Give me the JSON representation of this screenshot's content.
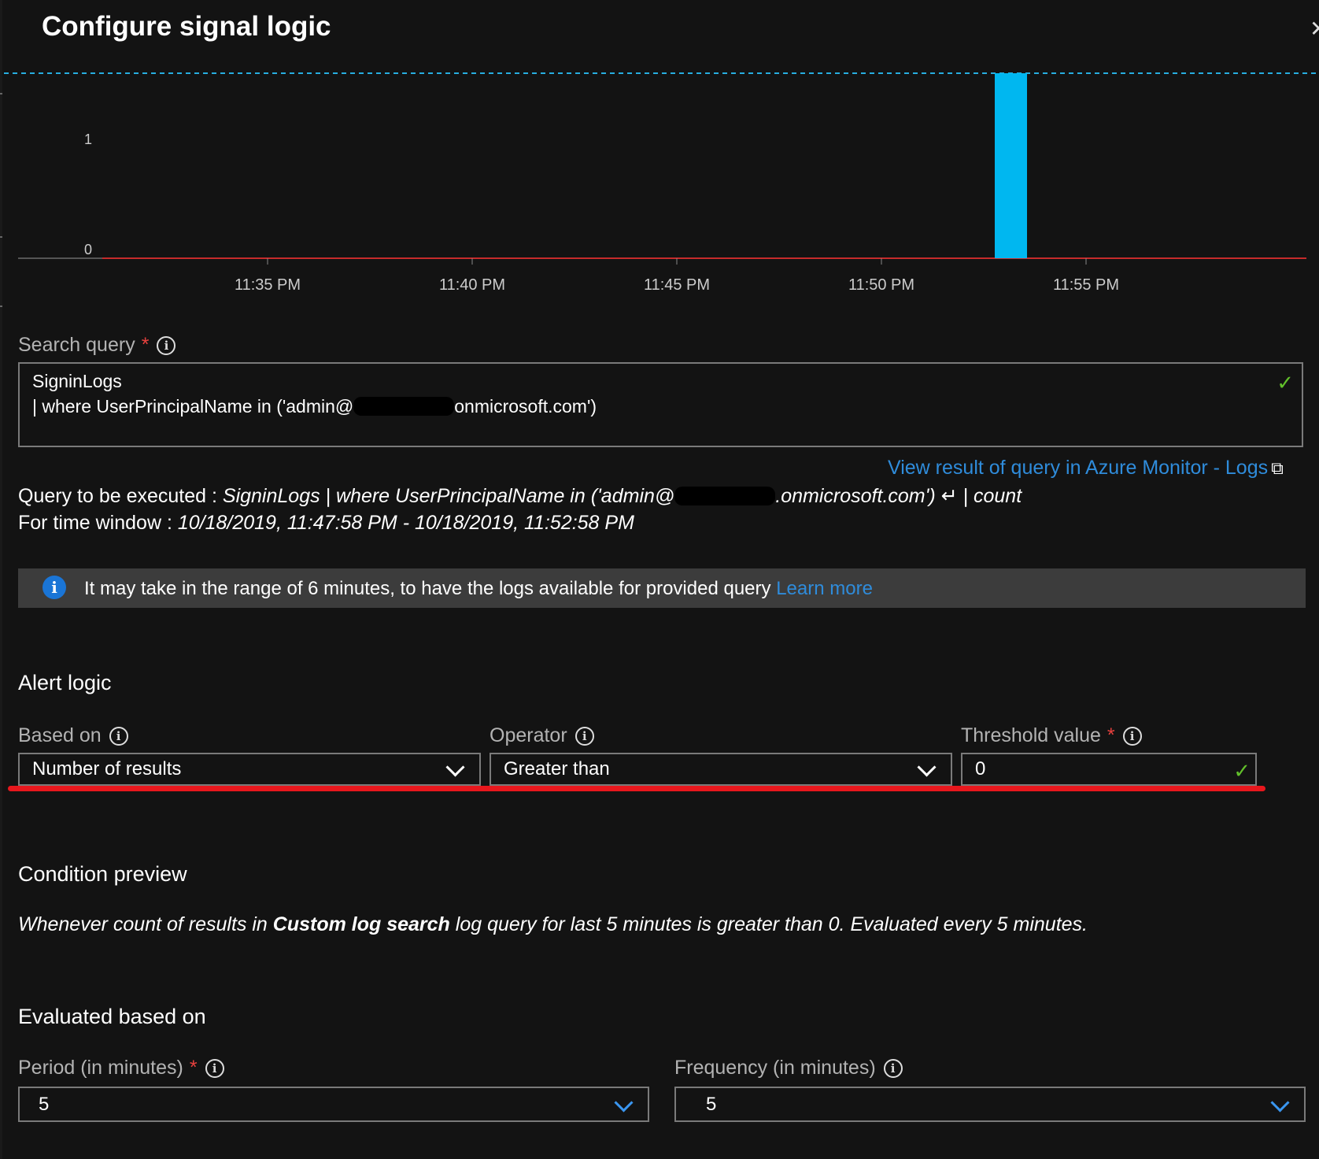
{
  "panel": {
    "title": "Configure signal logic",
    "close_icon": "close-icon"
  },
  "chart_data": {
    "type": "bar",
    "x": [
      "11:35 PM",
      "11:40 PM",
      "11:45 PM",
      "11:50 PM",
      "11:55 PM"
    ],
    "ytick_labels": [
      "0",
      "1"
    ],
    "bars": [
      {
        "time": "11:53 PM",
        "value": 1
      }
    ],
    "threshold": 1,
    "ylim": [
      0,
      1
    ],
    "colors": {
      "bar": "#00b7f0",
      "threshold": "#27aee0",
      "baseline": "#c62b2b"
    }
  },
  "search": {
    "label": "Search query",
    "required_mark": "*",
    "line1": "SigninLogs",
    "line2_prefix": "| where UserPrincipalName in ('admin@",
    "line2_suffix": "onmicrosoft.com')",
    "view_link": "View result of query in Azure Monitor - Logs"
  },
  "executed": {
    "label": "Query to be executed : ",
    "query_prefix": "SigninLogs | where UserPrincipalName in ('admin@",
    "query_suffix": ".onmicrosoft.com') ↵ | count",
    "window_label": "For time window : ",
    "window_value": "10/18/2019, 11:47:58 PM - 10/18/2019, 11:52:58 PM"
  },
  "info": {
    "text": "It may take in the range of 6 minutes, to have the logs available for provided query ",
    "link": "Learn more"
  },
  "alert_logic": {
    "heading": "Alert logic",
    "based_on_label": "Based on",
    "based_on_value": "Number of results",
    "operator_label": "Operator",
    "operator_value": "Greater than",
    "threshold_label": "Threshold value",
    "threshold_value": "0"
  },
  "condition": {
    "heading": "Condition preview",
    "part1": "Whenever count of results in ",
    "bold": "Custom log search",
    "part2": " log query for last 5 minutes is greater than 0. Evaluated every 5 minutes."
  },
  "evaluation": {
    "heading": "Evaluated based on",
    "period_label": "Period (in minutes)",
    "period_value": "5",
    "frequency_label": "Frequency (in minutes)",
    "frequency_value": "5"
  },
  "colors": {
    "accent": "#2f8cdb",
    "required": "#e8413e",
    "valid": "#62c02b",
    "annotation": "#e8171d"
  }
}
